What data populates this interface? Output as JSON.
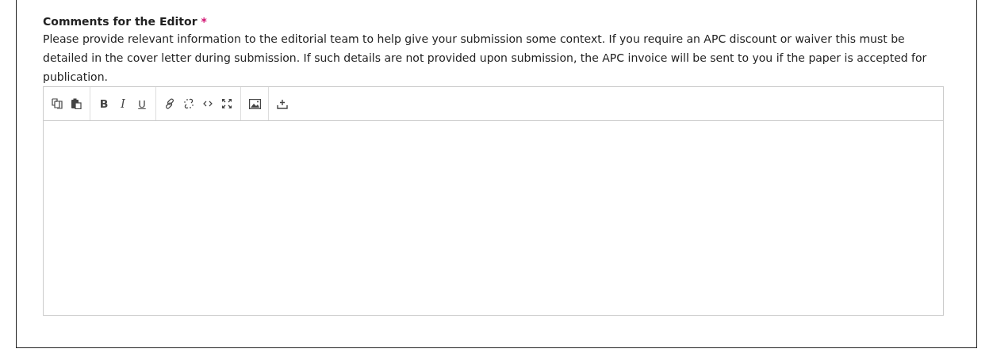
{
  "field": {
    "label": "Comments for the Editor",
    "required_mark": "*",
    "description": "Please provide relevant information to the editorial team to help give your submission some context. If you require an APC discount or waiver this must be detailed in the cover letter during submission. If such details are not provided upon submission, the APC invoice will be sent to you if the paper is accepted for publication."
  },
  "toolbar": [
    [
      {
        "kind": "copy"
      },
      {
        "kind": "paste"
      }
    ],
    [
      {
        "kind": "bold",
        "label": "B"
      },
      {
        "kind": "italic",
        "label": "I"
      },
      {
        "kind": "underline",
        "label": "U"
      }
    ],
    [
      {
        "kind": "link"
      },
      {
        "kind": "unlink"
      },
      {
        "kind": "code"
      },
      {
        "kind": "fullscreen"
      }
    ],
    [
      {
        "kind": "image"
      }
    ],
    [
      {
        "kind": "upload"
      }
    ]
  ]
}
